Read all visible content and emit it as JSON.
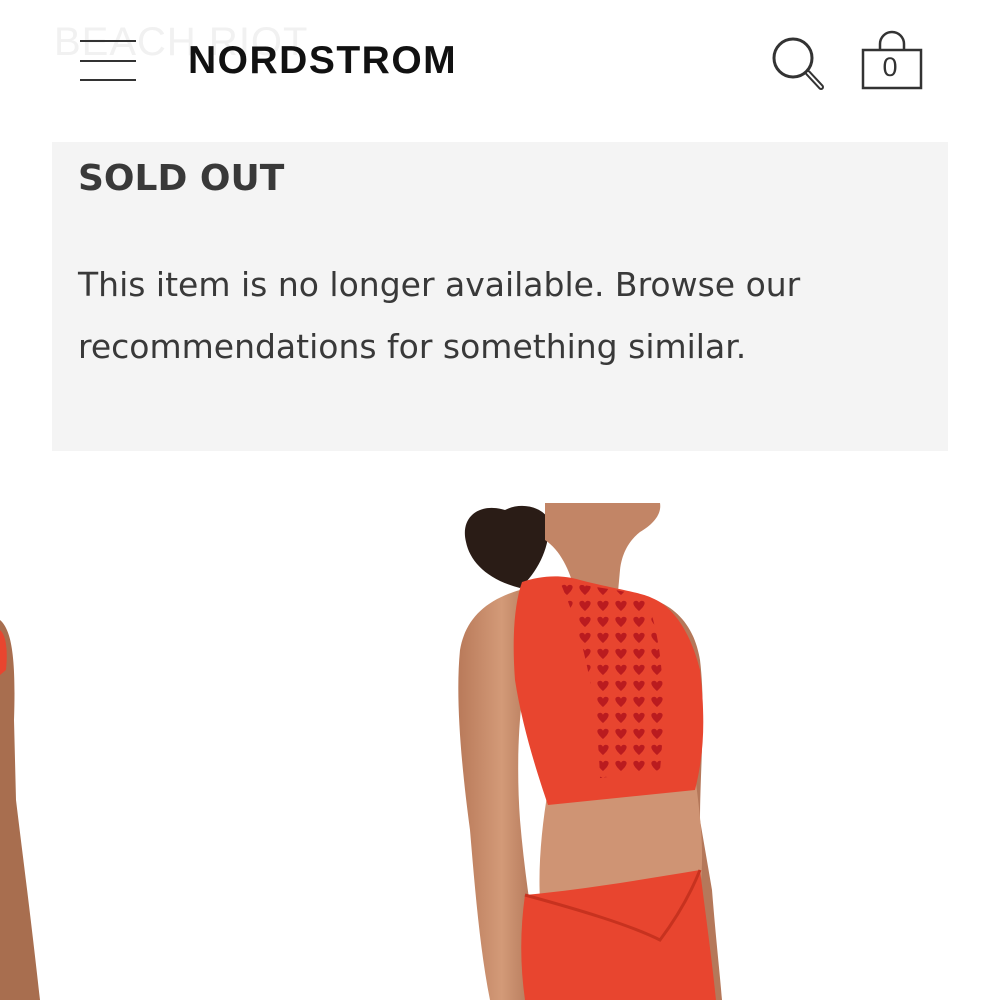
{
  "header": {
    "ghost_brand": "BEACH RIOT",
    "logo": "NORDSTROM",
    "menu_icon": "hamburger-menu-icon",
    "search_icon": "search-icon",
    "bag_icon": "shopping-bag-icon",
    "bag_count": "0"
  },
  "notice": {
    "title": "SOLD OUT",
    "message": "This item is no longer available. Browse our recommendations for something similar."
  },
  "colors": {
    "notice_background": "#f4f4f4",
    "text": "#393939",
    "product_red": "#e8452f",
    "heart_pattern": "#b5161d"
  }
}
